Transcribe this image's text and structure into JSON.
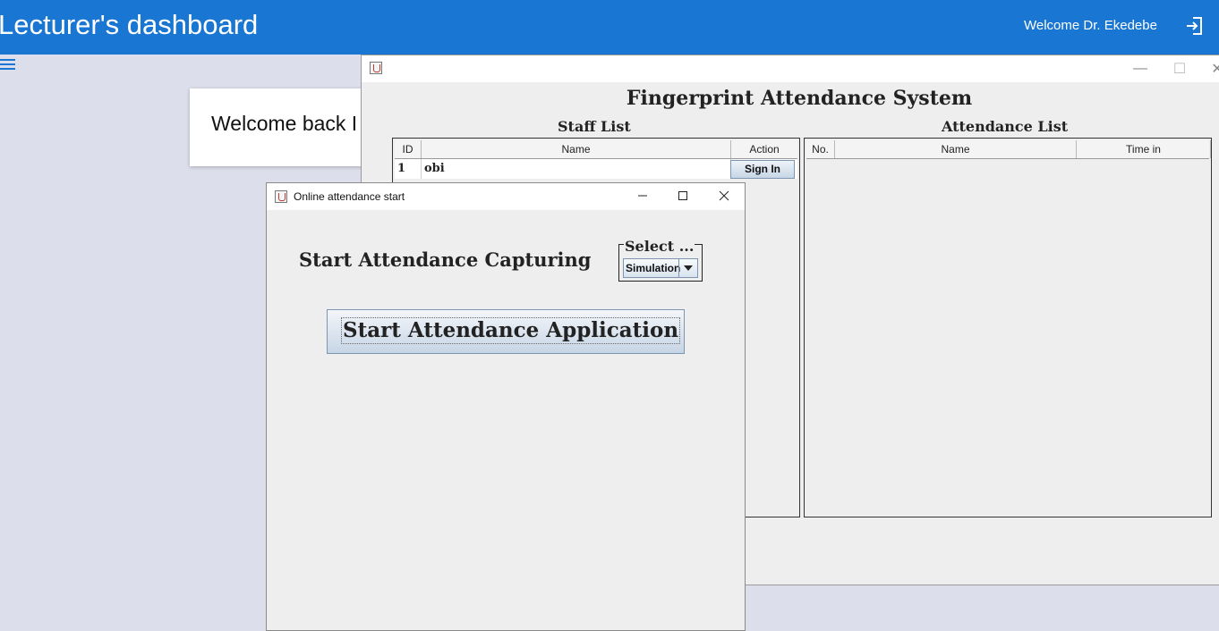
{
  "header": {
    "title": "Lecturer's dashboard",
    "welcome": "Welcome Dr. Ekedebe",
    "logout_icon": "logout-icon",
    "menu_icon": "hamburger-menu-icon",
    "color": "#1976d2"
  },
  "card": {
    "text": "Welcome back I"
  },
  "main_window": {
    "title": "Fingerprint Attendance System",
    "staff": {
      "title": "Staff List",
      "columns": [
        "ID",
        "Name",
        "Action"
      ],
      "rows": [
        {
          "id": "1",
          "name": "obi",
          "action": "Sign In"
        }
      ]
    },
    "attendance": {
      "title": "Attendance List",
      "columns": [
        "No.",
        "Name",
        "Time in"
      ]
    },
    "controls": {
      "minimize": "—",
      "maximize": "☐",
      "close": "✕"
    }
  },
  "dialog": {
    "title": "Online attendance start",
    "heading": "Start Attendance Capturing",
    "select_legend": "Select ...",
    "select_value": "Simulation",
    "start_button": "Start Attendance Application"
  }
}
